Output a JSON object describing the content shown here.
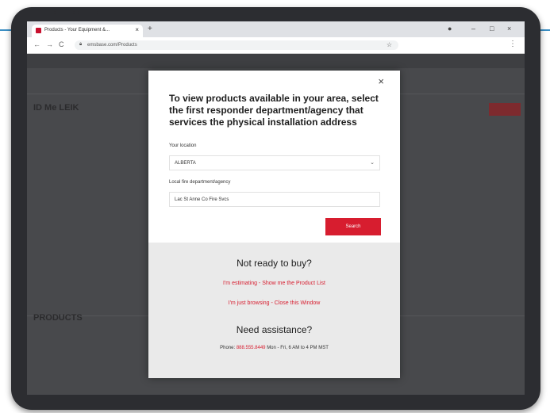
{
  "browser": {
    "tab_title": "Products - Your Equipment &...",
    "tab_close": "×",
    "new_tab": "+",
    "url": "emsbase.com/Products",
    "window_controls": {
      "profile": "●",
      "minimize": "–",
      "restore": "□",
      "close": "×"
    },
    "nav": {
      "back": "←",
      "forward": "→",
      "reload": "C"
    },
    "icons": {
      "lock": "lock-icon",
      "star": "star-icon",
      "menu": "more-vertical-icon"
    }
  },
  "background_page": {
    "heading": "ID Me LEIK",
    "heading_2": "PRODUCTS",
    "accent_color": "#c8102e"
  },
  "modal": {
    "close_label": "×",
    "title": "To view products available in your area, select the first responder department/agency that services the physical installation address",
    "location_label": "Your location",
    "location_value": "ALBERTA",
    "agency_label": "Local fire department/agency",
    "agency_value": "Lac St Anne Co Fire Svcs",
    "search_label": "Search",
    "not_ready_heading": "Not ready to buy?",
    "link_estimating": "I'm estimating - Show me the Product List",
    "link_browsing": "I'm just browsing - Close this Window",
    "assist_heading": "Need assistance?",
    "phone_prefix": "Phone:",
    "phone_number": "888.555.8449",
    "hours": "Mon - Fri, 6 AM to 4 PM MST",
    "colors": {
      "primary": "#d71d2f",
      "bottom_bg": "#eaeaea"
    }
  }
}
